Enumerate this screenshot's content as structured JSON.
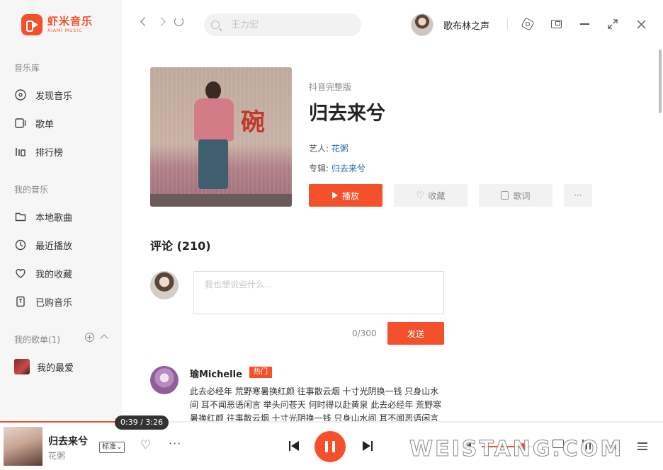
{
  "app": {
    "logo_cn": "虾米音乐",
    "logo_en": "XIAMI MUSIC",
    "accent": "#f4502c"
  },
  "sidebar": {
    "library_title": "音乐库",
    "library_items": [
      {
        "label": "发现音乐",
        "icon": "disc-icon"
      },
      {
        "label": "歌单",
        "icon": "playlist-icon"
      },
      {
        "label": "排行榜",
        "icon": "chart-icon"
      }
    ],
    "my_music_title": "我的音乐",
    "my_music_items": [
      {
        "label": "本地歌曲",
        "icon": "folder-icon"
      },
      {
        "label": "最近播放",
        "icon": "clock-icon"
      },
      {
        "label": "我的收藏",
        "icon": "heart-icon"
      },
      {
        "label": "已购音乐",
        "icon": "purchased-icon"
      }
    ],
    "my_playlists_title": "我的歌单(1)",
    "playlists": [
      {
        "label": "我的最爱"
      }
    ]
  },
  "topbar": {
    "search_placeholder": "王力宏",
    "user_name": "歌布林之声"
  },
  "song": {
    "subtitle": "抖音完整版",
    "title": "归去来兮",
    "artist_label": "艺人:",
    "artist": "花粥",
    "album_label": "专辑:",
    "album": "归去来兮",
    "cover_char": "碗",
    "buttons": {
      "play": "播放",
      "collect": "收藏",
      "lyrics": "歌词",
      "more": "···"
    }
  },
  "comments": {
    "heading": "评论 (210)",
    "input_placeholder": "我也想说些什么...",
    "char_count": "0/300",
    "send": "发送",
    "items": [
      {
        "user": "瑜Michelle",
        "badge": "热门",
        "text": "此去必经年 荒野寒暑换红颜 往事散云烟 十寸光阴换一钱 只身山水间 耳不闻恶语闲言 举头问苍天 何时得以赴黄泉 此去必经年 荒野寒暑换红颜 往事散云烟 十寸光阴换一钱 只身山水间 耳不闻恶语闲言"
      }
    ]
  },
  "player": {
    "title": "归去来兮",
    "artist": "花粥",
    "quality": "标准",
    "time": "0:39 / 3:26",
    "progress": 0.19,
    "volume": 0.8,
    "lyrics_btn": "词"
  },
  "watermark": "WEISTANG.COM"
}
